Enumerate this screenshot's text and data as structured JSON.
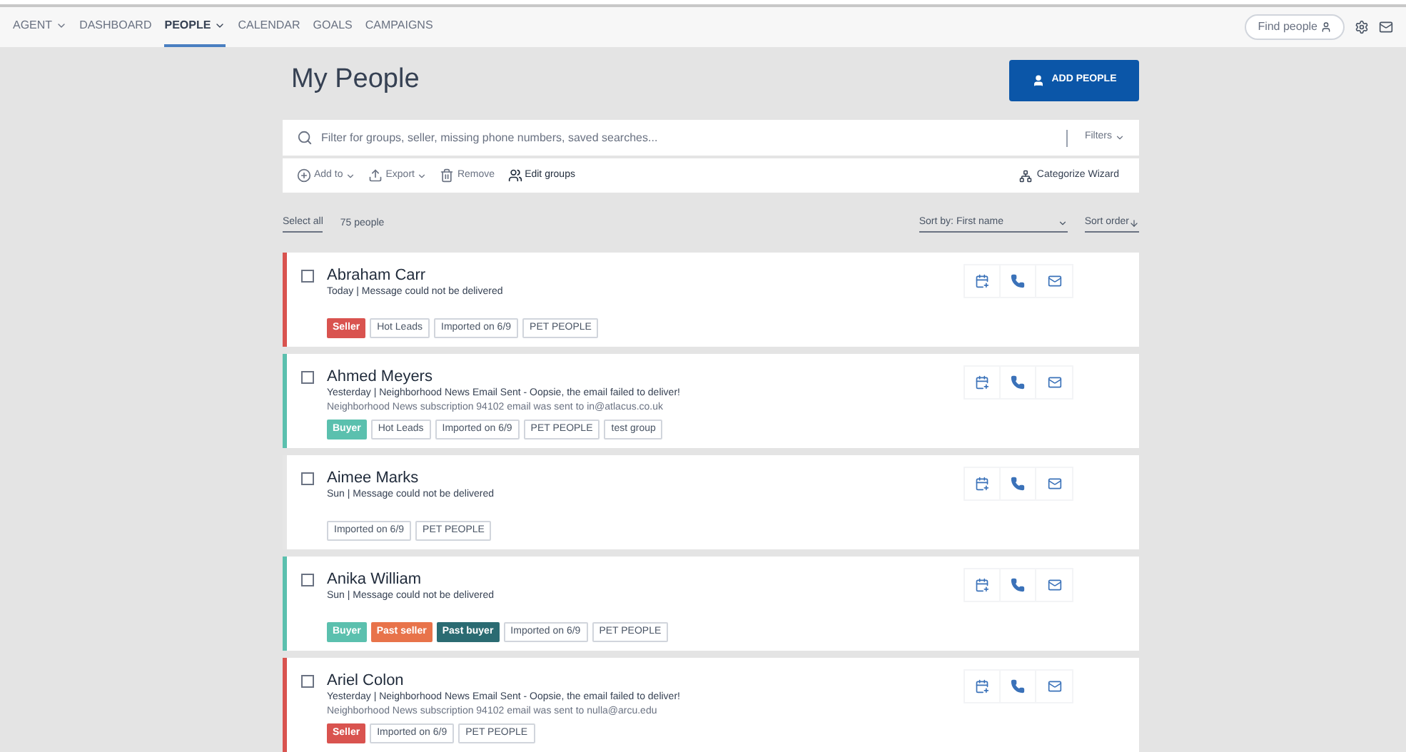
{
  "nav": {
    "items": [
      {
        "label": "AGENT",
        "dropdown": true,
        "selected": false
      },
      {
        "label": "DASHBOARD",
        "dropdown": false,
        "selected": false
      },
      {
        "label": "PEOPLE",
        "dropdown": true,
        "selected": true
      },
      {
        "label": "CALENDAR",
        "dropdown": false,
        "selected": false
      },
      {
        "label": "GOALS",
        "dropdown": false,
        "selected": false
      },
      {
        "label": "CAMPAIGNS",
        "dropdown": false,
        "selected": false
      }
    ],
    "find_people": "Find people"
  },
  "title": "My People",
  "add_button": "ADD PEOPLE",
  "search": {
    "placeholder": "Filter for groups, seller, missing phone numbers, saved searches...",
    "filters": "Filters"
  },
  "toolbar": {
    "items": [
      {
        "label": "Add to",
        "kind": "add",
        "disabled": true
      },
      {
        "label": "Export",
        "kind": "export",
        "disabled": true
      },
      {
        "label": "Remove",
        "kind": "remove",
        "disabled": true
      },
      {
        "label": "Edit groups",
        "kind": "groups",
        "disabled": false
      }
    ],
    "wizard": "Categorize Wizard"
  },
  "list_header": {
    "select_all": "Select all",
    "count": "75 people",
    "sort_by": "Sort by: First name",
    "sort_order": "Sort order"
  },
  "people": [
    {
      "name": "Abraham Carr",
      "checked": false,
      "color": "#d9534f",
      "lines": [
        "Today | Message could not be delivered"
      ],
      "tags": [
        {
          "label": "Seller",
          "kind": "status",
          "color": "#d9534f"
        },
        {
          "label": "Hot Leads",
          "kind": "group"
        },
        {
          "label": "Imported on 6/9",
          "kind": "group"
        },
        {
          "label": "PET PEOPLE",
          "kind": "group"
        }
      ]
    },
    {
      "name": "Ahmed Meyers",
      "checked": false,
      "color": "#5bc0ae",
      "lines": [
        "Yesterday | Neighborhood News Email Sent - Oopsie, the email failed to deliver!",
        "Neighborhood News subscription 94102 email was sent to in@atlacus.co.uk"
      ],
      "tags": [
        {
          "label": "Buyer",
          "kind": "status",
          "color": "#5bc0ae"
        },
        {
          "label": "Hot Leads",
          "kind": "group"
        },
        {
          "label": "Imported on 6/9",
          "kind": "group"
        },
        {
          "label": "PET PEOPLE",
          "kind": "group"
        },
        {
          "label": "test group",
          "kind": "group"
        }
      ]
    },
    {
      "name": "Aimee Marks",
      "checked": false,
      "color": "#e6e6e6",
      "lines": [
        "Sun | Message could not be delivered"
      ],
      "tags": [
        {
          "label": "Imported on 6/9",
          "kind": "group"
        },
        {
          "label": "PET PEOPLE",
          "kind": "group"
        }
      ]
    },
    {
      "name": "Anika William",
      "checked": false,
      "color": "#5bc0ae",
      "lines": [
        "Sun | Message could not be delivered"
      ],
      "tags": [
        {
          "label": "Buyer",
          "kind": "status",
          "color": "#5bc0ae"
        },
        {
          "label": "Past seller",
          "kind": "status",
          "color": "#e8734a"
        },
        {
          "label": "Past buyer",
          "kind": "status",
          "color": "#2b6b72"
        },
        {
          "label": "Imported on 6/9",
          "kind": "group"
        },
        {
          "label": "PET PEOPLE",
          "kind": "group"
        }
      ]
    },
    {
      "name": "Ariel Colon",
      "checked": false,
      "color": "#d9534f",
      "lines": [
        "Yesterday | Neighborhood News Email Sent - Oopsie, the email failed to deliver!",
        "Neighborhood News subscription 94102 email was sent to nulla@arcu.edu"
      ],
      "tags": [
        {
          "label": "Seller",
          "kind": "status",
          "color": "#d9534f"
        },
        {
          "label": "Imported on 6/9",
          "kind": "group"
        },
        {
          "label": "PET PEOPLE",
          "kind": "group"
        }
      ]
    }
  ]
}
